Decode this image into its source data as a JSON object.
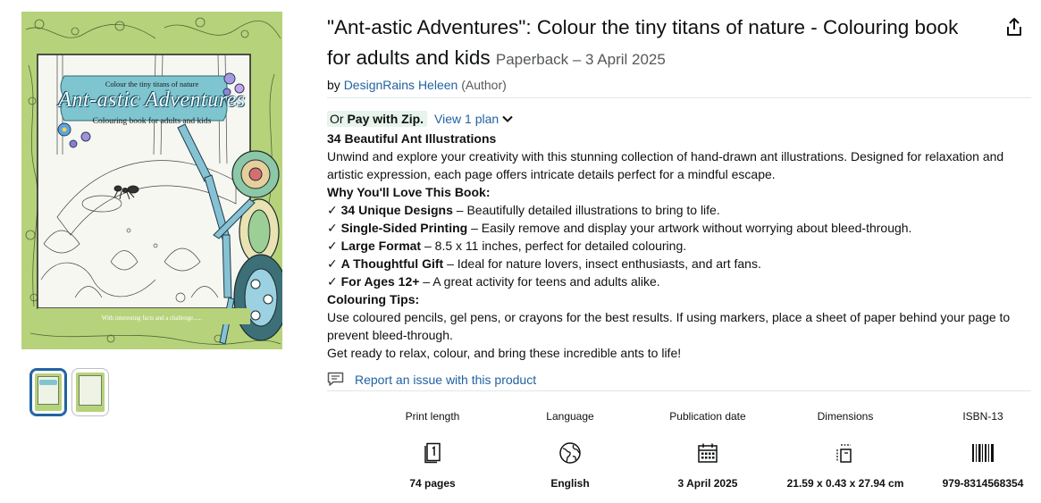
{
  "cover": {
    "line1": "Colour the tiny titans of nature",
    "line2": "Ant-astic Adventures",
    "line3": "Colouring book for adults and kids",
    "footer": "With interesting facts and a challenge......"
  },
  "product": {
    "title": "\"Ant-astic Adventures\": Colour the tiny titans of nature - Colouring book for adults and kids",
    "binding": "Paperback – 3 April 2025",
    "by": "by",
    "author": "DesignRains Heleen",
    "author_role": "(Author)"
  },
  "payment": {
    "or": "Or",
    "zip": "Pay with Zip.",
    "plan_link": "View 1 plan"
  },
  "description": {
    "heading": "34 Beautiful Ant Illustrations",
    "intro": "Unwind and explore your creativity with this stunning collection of hand-drawn ant illustrations. Designed for relaxation and artistic expression, each page offers intricate details perfect for a mindful escape.",
    "love_heading": "Why You'll Love This Book:",
    "bullets": [
      {
        "check": "✓",
        "bold": "34 Unique Designs",
        "text": " – Beautifully detailed illustrations to bring to life."
      },
      {
        "check": "✓",
        "bold": "Single-Sided Printing",
        "text": " – Easily remove and display your artwork without worrying about bleed-through."
      },
      {
        "check": "✓",
        "bold": "Large Format",
        "text": " – 8.5 x 11 inches, perfect for detailed colouring."
      },
      {
        "check": "✓",
        "bold": "A Thoughtful Gift",
        "text": " – Ideal for nature lovers, insect enthusiasts, and art fans."
      },
      {
        "check": "✓",
        "bold": "For Ages 12+",
        "text": " – A great activity for teens and adults alike."
      }
    ],
    "tips_heading": "Colouring Tips:",
    "tips": "Use coloured pencils, gel pens, or crayons for the best results. If using markers, place a sheet of paper behind your page to prevent bleed-through.",
    "closing": "Get ready to relax, colour, and bring these incredible ants to life!"
  },
  "report": {
    "label": "Report an issue with this product",
    "icon": "report-flag-icon"
  },
  "attributes": [
    {
      "label": "Print length",
      "icon": "book-pages-icon",
      "value": "74 pages"
    },
    {
      "label": "Language",
      "icon": "globe-icon",
      "value": "English"
    },
    {
      "label": "Publication date",
      "icon": "calendar-icon",
      "value": "3 April 2025"
    },
    {
      "label": "Dimensions",
      "icon": "dimensions-icon",
      "value": "21.59 x 0.43 x 27.94 cm"
    },
    {
      "label": "ISBN-13",
      "icon": "barcode-icon",
      "value": "979-8314568354"
    }
  ],
  "colors": {
    "link": "#2162a1",
    "cover_green": "#b6d37b",
    "zip_highlight": "#e6f4ec",
    "text": "#0f1111",
    "muted": "#565959"
  }
}
